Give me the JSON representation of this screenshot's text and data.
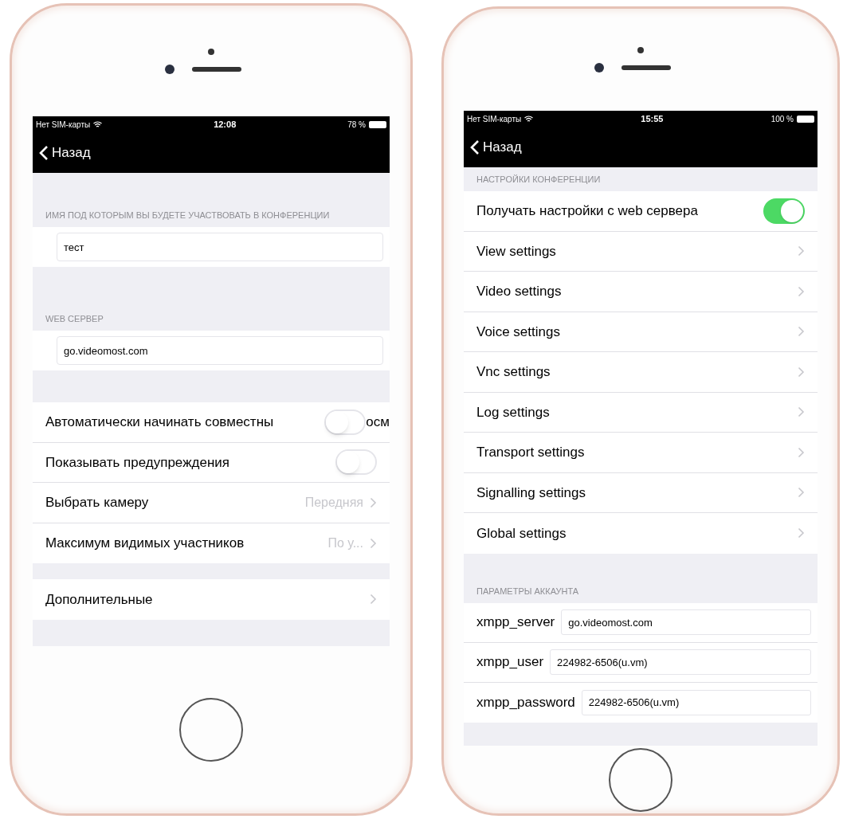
{
  "phones": [
    {
      "status_bar": {
        "carrier": "Нет SIM-карты",
        "time": "12:08",
        "battery": "78 %"
      },
      "nav": {
        "back": "Назад"
      },
      "sections": [
        {
          "kind": "field",
          "header": "ИМЯ ПОД КОТОРЫМ ВЫ БУДЕТЕ УЧАСТВОВАТЬ В КОНФЕРЕНЦИИ",
          "value": "тест"
        },
        {
          "kind": "field",
          "header": "WEB СЕРВЕР",
          "value": "go.videomost.com"
        },
        {
          "kind": "list",
          "rows": [
            {
              "kind": "toggle",
              "label": "Автоматически начинать совместны",
              "tail": "осм",
              "on": false
            },
            {
              "kind": "toggle",
              "label": "Показывать предупреждения",
              "on": false
            },
            {
              "kind": "link",
              "label": "Выбрать камеру",
              "value": "Передняя"
            },
            {
              "kind": "link",
              "label": "Максимум видимых участников",
              "value": "По у..."
            }
          ]
        },
        {
          "kind": "list",
          "rows": [
            {
              "kind": "link",
              "label": "Дополнительные"
            }
          ]
        }
      ]
    },
    {
      "status_bar": {
        "carrier": "Нет SIM-карты",
        "time": "15:55",
        "battery": "100 %"
      },
      "nav": {
        "back": "Назад"
      },
      "sections": [
        {
          "kind": "list",
          "header": "НАСТРОЙКИ КОНФЕРЕНЦИИ",
          "rows": [
            {
              "kind": "toggle",
              "label": "Получать настройки с web сервера",
              "on": true
            },
            {
              "kind": "link",
              "label": "View settings"
            },
            {
              "kind": "link",
              "label": "Video settings"
            },
            {
              "kind": "link",
              "label": "Voice settings"
            },
            {
              "kind": "link",
              "label": "Vnc settings"
            },
            {
              "kind": "link",
              "label": "Log settings"
            },
            {
              "kind": "link",
              "label": "Transport settings"
            },
            {
              "kind": "link",
              "label": "Signalling settings"
            },
            {
              "kind": "link",
              "label": "Global settings"
            }
          ]
        },
        {
          "kind": "form",
          "header": "ПАРАМЕТРЫ АККАУНТА",
          "rows": [
            {
              "label": "xmpp_server",
              "value": "go.videomost.com"
            },
            {
              "label": "xmpp_user",
              "value": "224982-6506(u.vm)"
            },
            {
              "label": "xmpp_password",
              "value": "224982-6506(u.vm)"
            }
          ]
        }
      ]
    }
  ]
}
